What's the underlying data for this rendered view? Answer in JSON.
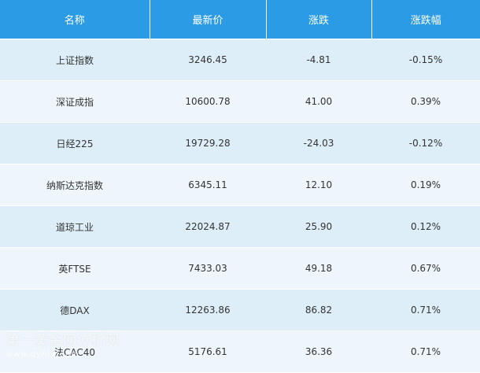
{
  "table": {
    "headers": [
      "名称",
      "最新价",
      "涨跌",
      "涨跌幅"
    ],
    "rows": [
      {
        "name": "上证指数",
        "price": "3246.45",
        "change": "-4.81",
        "pct": "-0.15%"
      },
      {
        "name": "深证成指",
        "price": "10600.78",
        "change": "41.00",
        "pct": "0.39%"
      },
      {
        "name": "日经225",
        "price": "19729.28",
        "change": "-24.03",
        "pct": "-0.12%"
      },
      {
        "name": "纳斯达克指数",
        "price": "6345.11",
        "change": "12.10",
        "pct": "0.19%"
      },
      {
        "name": "道琼工业",
        "price": "22024.87",
        "change": "25.90",
        "pct": "0.12%"
      },
      {
        "name": "英FTSE",
        "price": "7433.03",
        "change": "49.18",
        "pct": "0.67%"
      },
      {
        "name": "德DAX",
        "price": "12263.86",
        "change": "86.82",
        "pct": "0.71%"
      },
      {
        "name": "法CAC40",
        "price": "5176.61",
        "change": "36.36",
        "pct": "0.71%"
      }
    ]
  },
  "watermark": {
    "line1": "第一黄金网分析网",
    "line2": "www.dyhjw.com"
  },
  "colors": {
    "header_bg": "#2b9be6",
    "row_alt_a": "#ddeef8",
    "row_alt_b": "#eef6fc",
    "text": "#333333"
  }
}
